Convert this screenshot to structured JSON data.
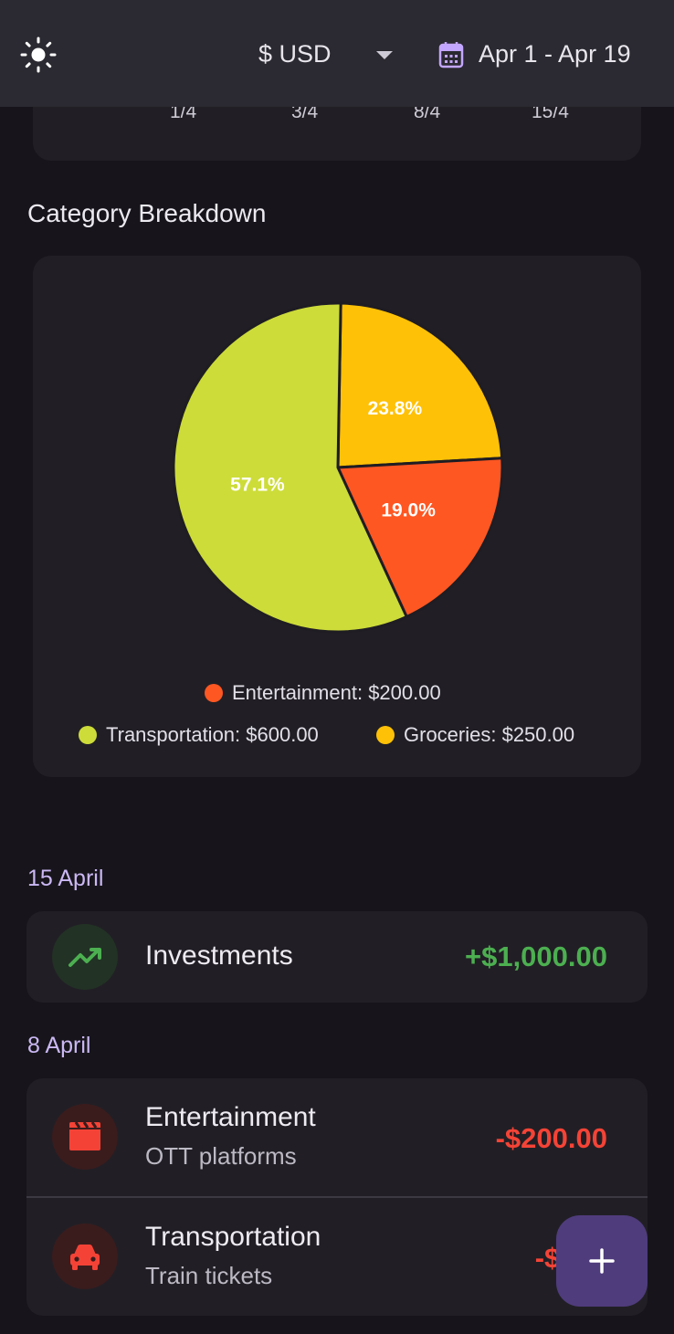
{
  "appbar": {
    "theme_icon": "sun-icon",
    "currency": "$ USD",
    "currency_dropdown_icon": "chevron-down-icon",
    "calendar_icon": "calendar-icon",
    "date_range": "Apr 1 - Apr 19"
  },
  "trend_chart": {
    "x_ticks": [
      "1/4",
      "3/4",
      "8/4",
      "15/4"
    ]
  },
  "breakdown": {
    "title": "Category Breakdown",
    "legend": [
      {
        "label": "Entertainment: $200.00",
        "color": "#ff5722"
      },
      {
        "label": "Transportation: $600.00",
        "color": "#cddc39"
      },
      {
        "label": "Groceries: $250.00",
        "color": "#ffc107"
      }
    ]
  },
  "chart_data": {
    "type": "pie",
    "title": "Category Breakdown",
    "slices": [
      {
        "name": "Groceries",
        "value": 250,
        "percent_label": "23.8%",
        "color": "#ffc107"
      },
      {
        "name": "Entertainment",
        "value": 200,
        "percent_label": "19.0%",
        "color": "#ff5722"
      },
      {
        "name": "Transportation",
        "value": 600,
        "percent_label": "57.1%",
        "color": "#cddc39"
      }
    ]
  },
  "transactions": [
    {
      "date": "15 April",
      "items": [
        {
          "title": "Investments",
          "subtitle": "",
          "amount": "+$1,000.00",
          "amount_color": "#4caf50",
          "icon": "trending-up-icon"
        }
      ]
    },
    {
      "date": "8 April",
      "items": [
        {
          "title": "Entertainment",
          "subtitle": "OTT platforms",
          "amount": "-$200.00",
          "amount_color": "#f44336",
          "icon": "clapperboard-icon"
        },
        {
          "title": "Transportation",
          "subtitle": "Train tickets",
          "amount": "-$600",
          "amount_color": "#f44336",
          "icon": "car-icon"
        }
      ]
    }
  ],
  "fab": {
    "icon": "plus-icon"
  }
}
